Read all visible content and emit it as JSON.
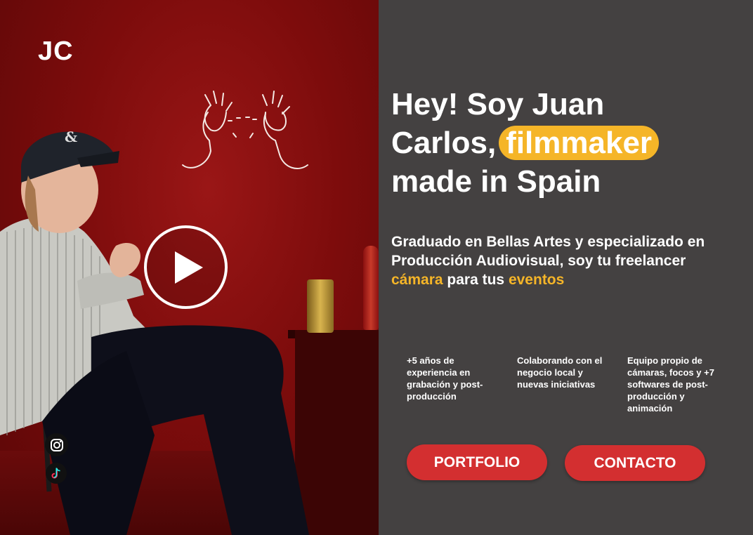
{
  "brand": {
    "logo_text": "JC"
  },
  "hero": {
    "headline_part1": "Hey! Soy Juan Carlos,",
    "headline_highlight": "filmmaker",
    "headline_part2": "made in Spain",
    "intro_part1": "Graduado en Bellas Artes y especializado en Producción Audiovisual, soy tu freelancer",
    "intro_accent1": "cámara",
    "intro_part2": "para tus",
    "intro_accent2": "eventos"
  },
  "features": [
    {
      "text": "+5 años de experiencia en grabación y post-producción"
    },
    {
      "text": "Colaborando con el negocio local y nuevas iniciativas"
    },
    {
      "text": "Equipo propio de cámaras, focos y +7 softwares de post-producción y animación"
    }
  ],
  "buttons": {
    "portfolio": "PORTFOLIO",
    "contacto": "CONTACTO"
  },
  "social": [
    {
      "icon": "instagram-icon"
    },
    {
      "icon": "tiktok-icon"
    }
  ],
  "colors": {
    "background": "#444141",
    "accent": "#f5b528",
    "button": "#d32f30",
    "video_bg": "#7d0c0c"
  }
}
